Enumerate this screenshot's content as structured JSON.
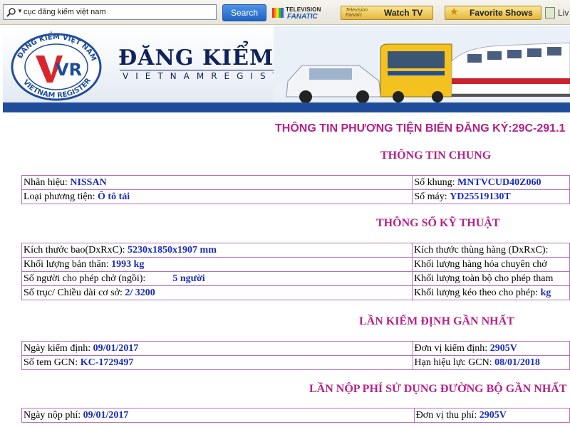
{
  "toolbar": {
    "search_value": "cục đăng kiểm việt nam",
    "search_button": "Search",
    "tv_logo_top": "TELEVISION",
    "tv_logo_bottom": "FANATIC",
    "watch_mini_1": "Television",
    "watch_mini_2": "Fanatic",
    "watch_label": "Watch TV",
    "favorite_label": "Favorite Shows",
    "extra_label": "Liv",
    "icons": [
      "search-icon",
      "dropdown-caret-icon",
      "tv-fanatic-logo",
      "star-icon",
      "live-icon"
    ]
  },
  "banner": {
    "brand": "ĐĂNG KIỂM VIỆT NAM",
    "brand_sub": "VIETNAMREGISTER",
    "logo_top": "ĐĂNG KIỂM VIỆT NAM",
    "logo_bottom": "VIETNAM REGISTER",
    "logo_mark": "VR"
  },
  "page": {
    "main_title": "THÔNG TIN PHƯƠNG TIỆN BIỂN ĐĂNG KÝ:29C-291.1",
    "sections": {
      "general": {
        "title": "THÔNG TIN CHUNG",
        "rows": [
          {
            "left_label": "Nhãn hiệu: ",
            "left_value": "NISSAN",
            "right_label": "Số khung: ",
            "right_value": "MNTVCUD40Z060"
          },
          {
            "left_label": "Loại phương tiện: ",
            "left_value": "Ô tô tải",
            "right_label": "Số máy: ",
            "right_value": "YD25519130T"
          }
        ]
      },
      "specs": {
        "title": "THÔNG SỐ KỸ THUẬT",
        "rows": [
          {
            "left_label": "Kích thước bao(DxRxC): ",
            "left_value": "5230x1850x1907 mm",
            "right_label": "Kích thước thùng hàng (DxRxC):",
            "right_value": ""
          },
          {
            "left_label": "Khối lượng bản thân: ",
            "left_value": "1993 kg",
            "right_label": "Khối lượng hàng hóa chuyên chở",
            "right_value": ""
          },
          {
            "left_label": "Số người cho phép chở (ngồi):",
            "left_value": "5 người",
            "right_label": "Khối lượng toàn bộ cho phép tham",
            "right_value": ""
          },
          {
            "left_label": "Số trục/ Chiều dài cơ sở: ",
            "left_value": "2/ 3200",
            "right_label": "Khối lượng kéo theo cho phép: ",
            "right_value": "kg"
          }
        ]
      },
      "inspection": {
        "title": "LẦN KIỂM ĐỊNH GẦN NHẤT",
        "rows": [
          {
            "left_label": "Ngày kiểm định: ",
            "left_value": "09/01/2017",
            "right_label": "Đơn vị kiểm định: ",
            "right_value": "2905V"
          },
          {
            "left_label": "Số tem GCN: ",
            "left_value": "KC-1729497",
            "right_label": "Hạn hiệu lực GCN: ",
            "right_value": "08/01/2018"
          }
        ]
      },
      "road_fee": {
        "title": "LẦN NỘP PHÍ SỬ DỤNG ĐƯỜNG BỘ GẦN NHẤT",
        "rows": [
          {
            "left_label": "Ngày nộp phí: ",
            "left_value": "09/01/2017",
            "right_label": "Đơn vị thu phí: ",
            "right_value": "2905V"
          }
        ]
      }
    }
  },
  "colors": {
    "section_title": "#b5218a",
    "value_text": "#1a2bbf",
    "table_border": "#b56fbf",
    "brand_navy": "#10225a"
  }
}
